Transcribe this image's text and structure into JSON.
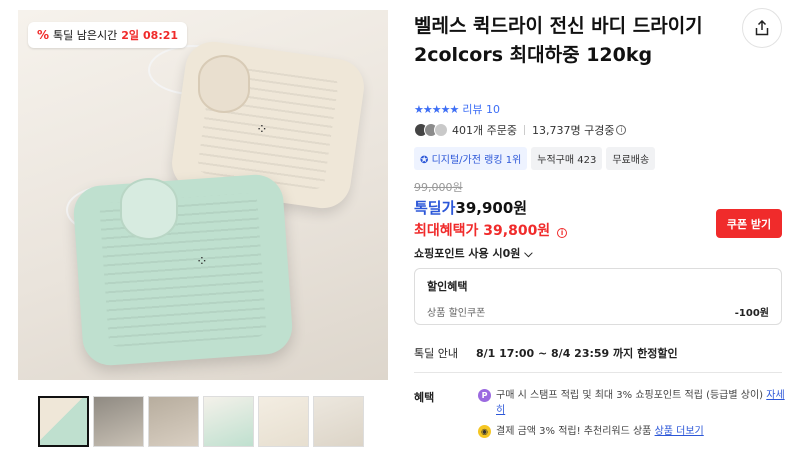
{
  "timer_badge": {
    "icon": "percent-icon",
    "label": "톡딜 남은시간",
    "days": "2일",
    "time": "08:21"
  },
  "product": {
    "title": "벨레스 퀵드라이 전신 바디 드라이기 2colcors 최대하중 120kg",
    "rating_stars": 5,
    "review_label": "리뷰 10"
  },
  "buyers": {
    "order_count": "401개 주문중",
    "subscribers": "13,737명 구경중"
  },
  "tags": {
    "rank": "디지털/가전 랭킹 1위",
    "cumulative": "누적구매 423",
    "shipping": "무료배송"
  },
  "price": {
    "original": "99,000원",
    "deal_label": "톡딜가",
    "deal": "39,900원",
    "max_label": "최대혜택가",
    "max": "39,800원",
    "coupon_button": "쿠폰 받기",
    "point_use": "쇼핑포인트 사용 시0원"
  },
  "discount": {
    "header": "할인혜택",
    "item_label": "상품 할인쿠폰",
    "item_amount": "-100원"
  },
  "deal_info": {
    "label": "톡딜 안내",
    "period": "8/1 17:00 ~ 8/4 23:59 까지 한정할인"
  },
  "benefits": {
    "label": "혜택",
    "b1_text": "구매 시 스탬프 적립 및 최대 3% 쇼핑포인트 적립 (등급별 상이)",
    "b1_link": "자세히",
    "b2_text": "결제 금액 3% 적립! 추천리워드 상품",
    "b2_link": "상품 더보기"
  },
  "colors": {
    "accent_red": "#f02b2b",
    "accent_blue": "#2c57d8",
    "rating_blue": "#3d6ef5"
  }
}
